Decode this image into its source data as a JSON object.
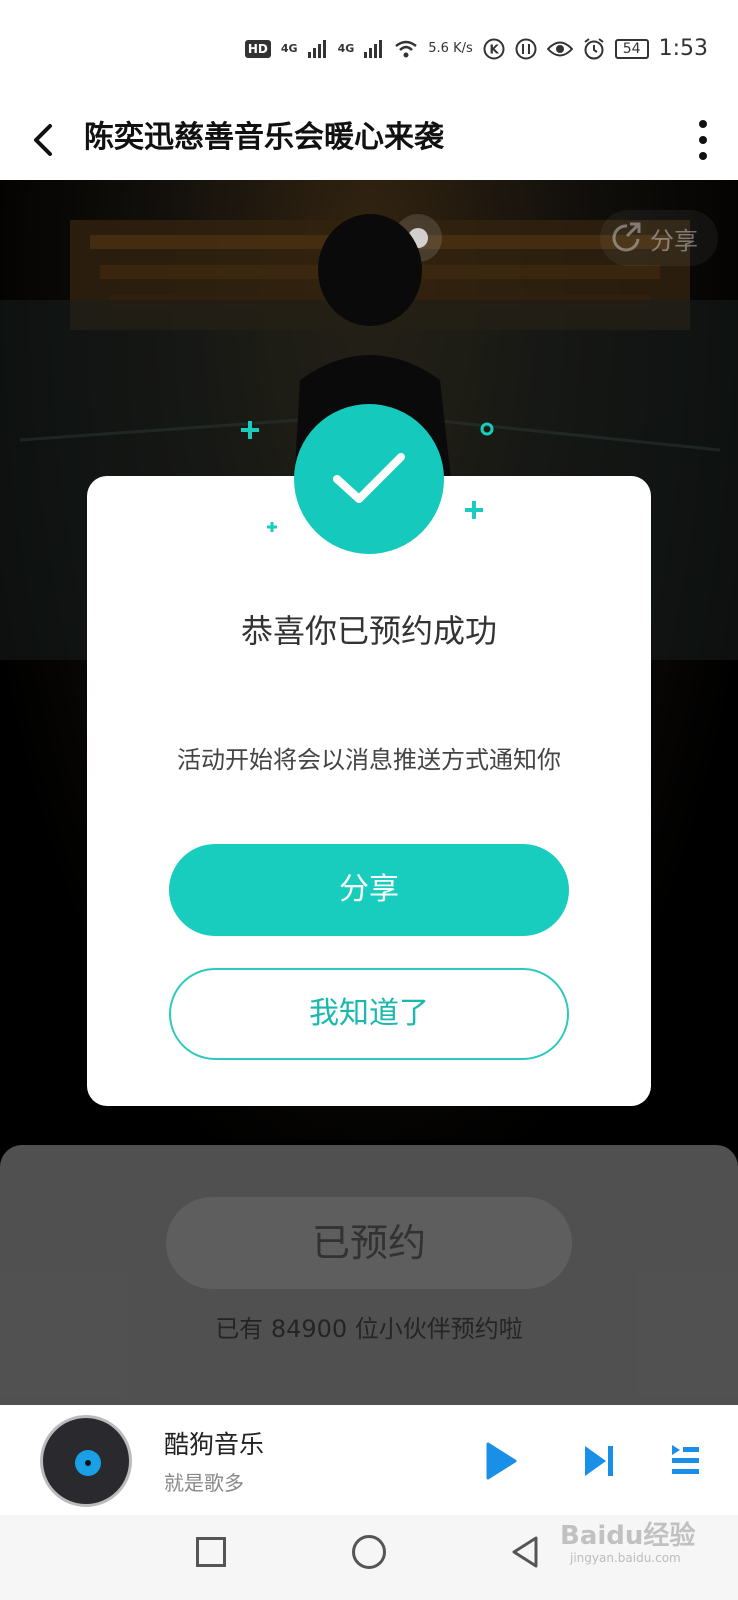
{
  "status_bar": {
    "hd": "HD",
    "net1": "4G",
    "net2": "4G",
    "speed": "5.6 K/s",
    "battery": "54",
    "time": "1:53"
  },
  "header": {
    "title": "陈奕迅慈善音乐会暖心来袭"
  },
  "hero": {
    "share_label": "分享"
  },
  "modal": {
    "title": "恭喜你已预约成功",
    "message": "活动开始将会以消息推送方式通知你",
    "share_button": "分享",
    "got_it_button": "我知道了",
    "accent_color": "#16c9bd"
  },
  "reservation": {
    "reserved_label": "已预约",
    "count_text": "已有 84900 位小伙伴预约啦"
  },
  "player": {
    "title": "酷狗音乐",
    "subtitle": "就是歌多"
  },
  "watermark": {
    "brand": "Baidu经验",
    "domain": "jingyan.baidu.com"
  }
}
